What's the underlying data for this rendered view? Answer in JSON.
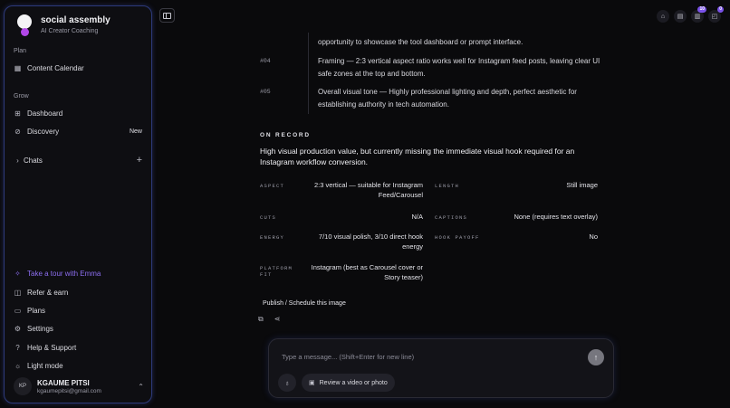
{
  "brand": {
    "name": "social assembly",
    "subtitle": "AI Creator Coaching"
  },
  "sidebar": {
    "plan_label": "Plan",
    "plan_items": [
      {
        "label": "Content Calendar",
        "icon": "calendar-icon"
      }
    ],
    "grow_label": "Grow",
    "grow_items": [
      {
        "label": "Dashboard",
        "icon": "grid-icon"
      },
      {
        "label": "Discovery",
        "icon": "compass-icon",
        "badge": "New"
      }
    ],
    "chats_label": "Chats",
    "bottom_items": [
      {
        "label": "Take a tour with Emma",
        "icon": "sparkle-icon"
      },
      {
        "label": "Refer & earn",
        "icon": "gift-icon"
      },
      {
        "label": "Plans",
        "icon": "card-icon"
      },
      {
        "label": "Settings",
        "icon": "gear-icon"
      },
      {
        "label": "Help & Support",
        "icon": "help-icon"
      },
      {
        "label": "Light mode",
        "icon": "sun-icon"
      }
    ],
    "user": {
      "initials": "KP",
      "name": "KGAUME PITSI",
      "email": "kgaumepitsi@gmail.com"
    }
  },
  "topbar": {
    "badges": [
      "10",
      "0"
    ]
  },
  "main": {
    "top_text": "opportunity to showcase the tool dashboard or prompt interface.",
    "items": [
      {
        "num": "#04",
        "text": "Framing — 2:3 vertical aspect ratio works well for Instagram feed posts, leaving clear UI safe zones at the top and bottom."
      },
      {
        "num": "#05",
        "text": "Overall visual tone — Highly professional lighting and depth, perfect aesthetic for establishing authority in tech automation."
      }
    ],
    "on_record_label": "ON RECORD",
    "summary": "High visual production value, but currently missing the immediate visual hook required for an Instagram workflow conversion.",
    "fields": {
      "aspect": {
        "label": "ASPECT",
        "value": "2:3 vertical — suitable for Instagram Feed/Carousel"
      },
      "length": {
        "label": "LENGTH",
        "value": "Still image"
      },
      "cuts": {
        "label": "CUTS",
        "value": "N/A"
      },
      "captions": {
        "label": "CAPTIONS",
        "value": "None (requires text overlay)"
      },
      "energy": {
        "label": "ENERGY",
        "value": "7/10 visual polish, 3/10 direct hook energy"
      },
      "hook_payoff": {
        "label": "HOOK PAYOFF",
        "value": "No"
      },
      "platform_fit": {
        "label": "PLATFORM FIT",
        "value": "Instagram (best as Carousel cover or Story teaser)"
      }
    },
    "publish_label": "Publish / Schedule this image"
  },
  "composer": {
    "placeholder": "Type a message... (Shift+Enter for new line)",
    "review_label": "Review a video or photo"
  }
}
